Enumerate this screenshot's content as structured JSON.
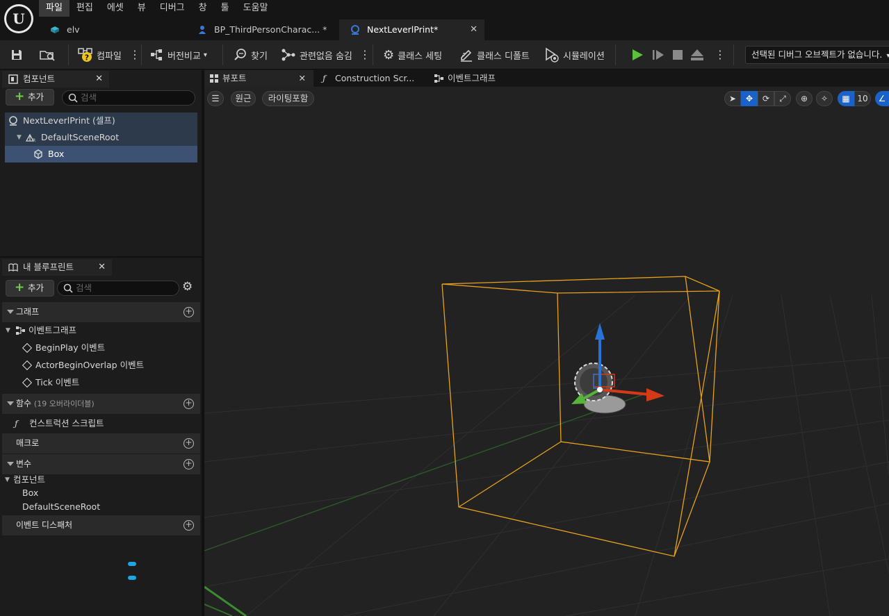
{
  "menu": {
    "items": [
      "파일",
      "편집",
      "에셋",
      "뷰",
      "디버그",
      "창",
      "툴",
      "도움말"
    ],
    "active_index": 0
  },
  "doc_tabs": [
    {
      "label": "elv",
      "icon": "level-icon"
    },
    {
      "label": "BP_ThirdPersonCharac... *",
      "icon": "blueprint-character-icon"
    },
    {
      "label": "NextLeverlPrint*",
      "icon": "blueprint-actor-icon",
      "active": true
    }
  ],
  "toolbar": {
    "compile_label": "컴파일",
    "diff_label": "버전비교",
    "find_label": "찾기",
    "hide_unrelated_label": "관련없음 숨김",
    "class_settings_label": "클래스 세팅",
    "class_defaults_label": "클래스 디폴트",
    "simulation_label": "시뮬레이션",
    "debug_object": "선택된 디버그 오브젝트가 없습니다."
  },
  "components_panel": {
    "title": "컴포넌트",
    "add_label": "추가",
    "search_placeholder": "검색",
    "tree": [
      {
        "label": "NextLeverlPrint (셀프)",
        "indent": 0
      },
      {
        "label": "DefaultSceneRoot",
        "indent": 1
      },
      {
        "label": "Box",
        "indent": 2,
        "selected": true
      }
    ]
  },
  "my_blueprint": {
    "title": "내 블루프린트",
    "add_label": "추가",
    "search_placeholder": "검색",
    "graphs_header": "그래프",
    "event_graph": "이벤트그래프",
    "events": [
      "BeginPlay 이벤트",
      "ActorBeginOverlap 이벤트",
      "Tick 이벤트"
    ],
    "functions_header": "함수",
    "functions_sub": "(19 오버라이더블)",
    "construction_script": "컨스트럭션 스크립트",
    "macros_header": "매크로",
    "variables_header": "변수",
    "components_category": "컴포넌트",
    "variables": [
      "Box",
      "DefaultSceneRoot"
    ],
    "dispatchers_header": "이벤트 디스패처"
  },
  "viewport_tabs": [
    {
      "label": "뷰포트",
      "active": true
    },
    {
      "label": "Construction Scr..."
    },
    {
      "label": "이벤트그래프"
    }
  ],
  "viewport": {
    "perspective_label": "원근",
    "lighting_label": "라이팅포함",
    "grid_snap": "10"
  },
  "colors": {
    "accent_blue": "#1b62c8",
    "selection": "#3d5272",
    "box_outline": "#e8a21c",
    "play_green": "#5cc13a",
    "variable_pill": "#1aa7e8"
  }
}
